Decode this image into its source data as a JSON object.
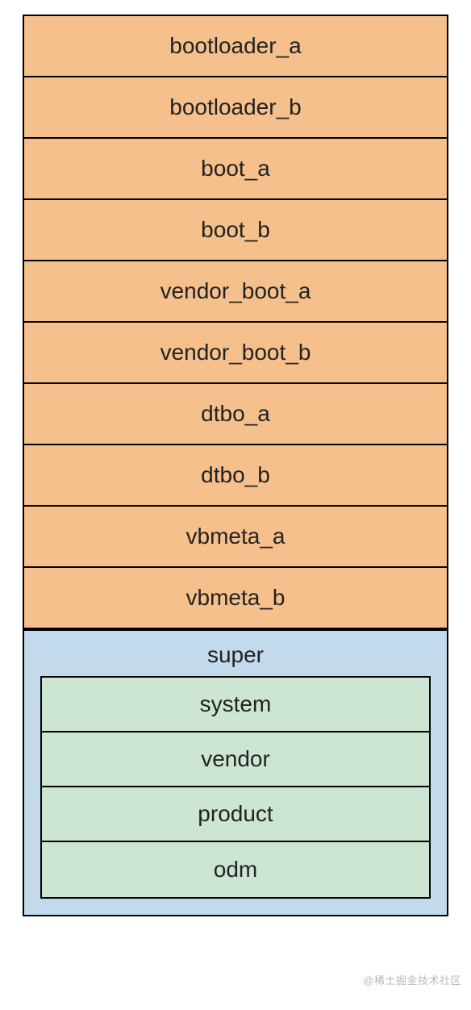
{
  "partitions": [
    "bootloader_a",
    "bootloader_b",
    "boot_a",
    "boot_b",
    "vendor_boot_a",
    "vendor_boot_b",
    "dtbo_a",
    "dtbo_b",
    "vbmeta_a",
    "vbmeta_b"
  ],
  "super": {
    "title": "super",
    "inner": [
      "system",
      "vendor",
      "product",
      "odm"
    ]
  },
  "watermark": "@稀土掘金技术社区"
}
